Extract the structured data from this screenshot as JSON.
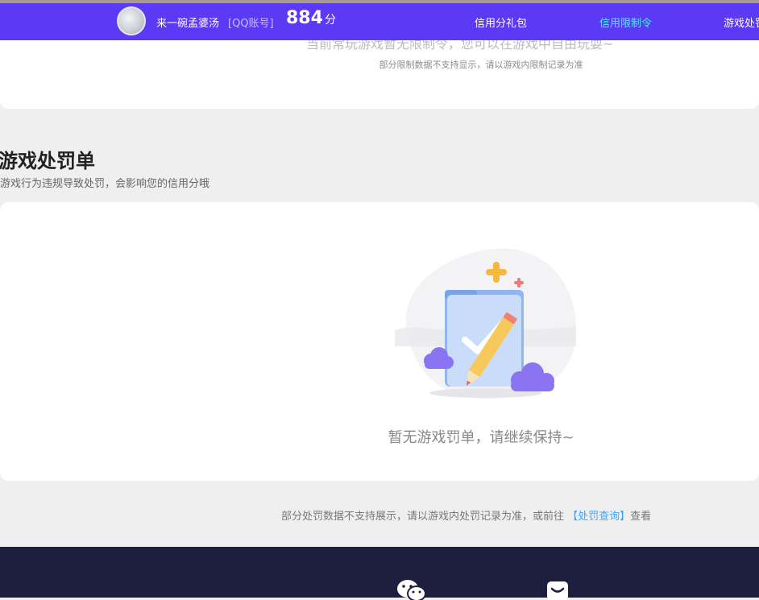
{
  "header": {
    "nickname": "来一碗孟婆汤",
    "account_tag": "[QQ账号]",
    "score": "884",
    "score_unit": "分",
    "nav": [
      {
        "label": "信用分礼包"
      },
      {
        "label": "信用限制令"
      },
      {
        "label": "游戏处罚"
      }
    ]
  },
  "limit_section": {
    "cut_text": "当前常玩游戏暂无限制令，您可以在游戏中自由玩耍~",
    "note": "部分限制数据不支持显示，请以游戏内限制记录为准"
  },
  "penalty_section": {
    "title": "游戏处罚单",
    "subtitle": "游戏行为违规导致处罚，会影响您的信用分哦",
    "empty_text": "暂无游戏罚单，请继续保持~"
  },
  "bottom_note": {
    "text": "部分处罚数据不支持展示，请以游戏内处罚记录为准，或前往",
    "link": "【处罚查询】",
    "suffix": "查看"
  },
  "colors": {
    "topbar": "#5b3af5",
    "active_nav": "#5de3ff",
    "footer": "#1e1e3f",
    "link": "#3aa6ff"
  },
  "icons": {
    "footer_left": "wechat-icon",
    "footer_right": "qq-icon"
  }
}
